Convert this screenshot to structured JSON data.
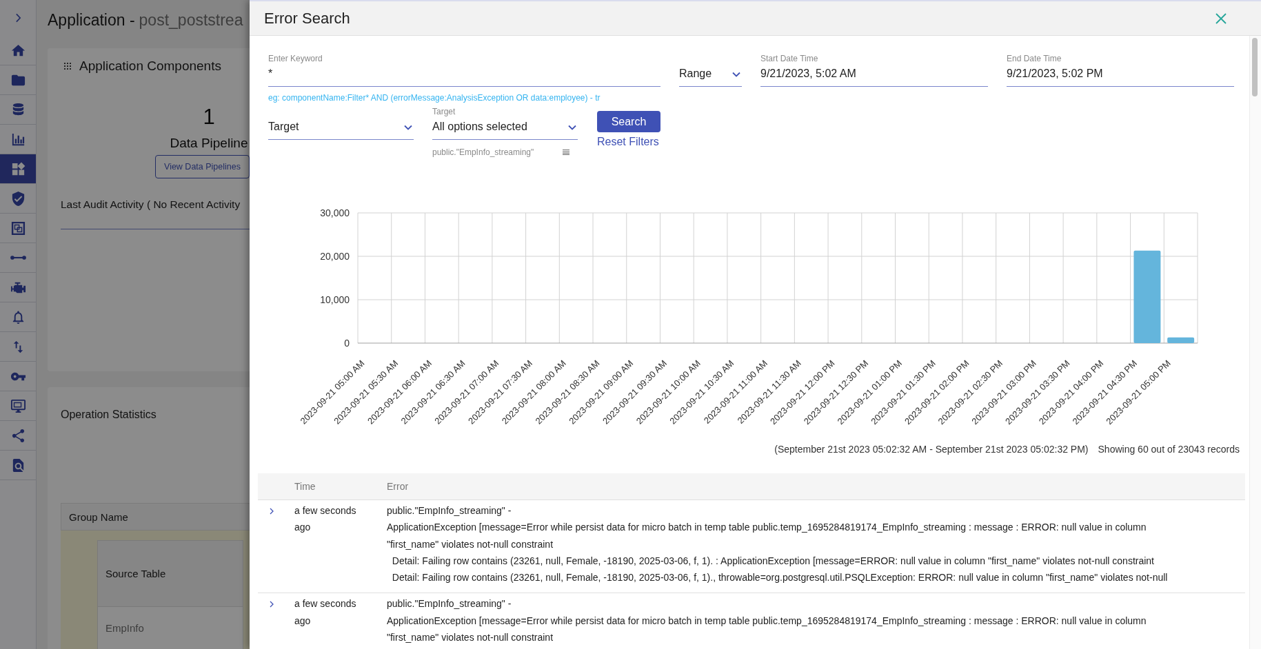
{
  "sidebar": {
    "items": [
      {
        "kind": "home",
        "selected": false
      },
      {
        "kind": "folder",
        "selected": false
      },
      {
        "kind": "database",
        "selected": false
      },
      {
        "kind": "chart",
        "selected": false
      },
      {
        "kind": "widgets",
        "selected": true
      },
      {
        "kind": "shield",
        "selected": false
      },
      {
        "kind": "layers",
        "selected": false
      },
      {
        "kind": "connector",
        "selected": false
      },
      {
        "kind": "engine",
        "selected": false
      },
      {
        "kind": "bell",
        "selected": false
      },
      {
        "kind": "transfer",
        "selected": false
      },
      {
        "kind": "key",
        "selected": false
      },
      {
        "kind": "monitor",
        "selected": false
      },
      {
        "kind": "share",
        "selected": false
      },
      {
        "kind": "search_doc",
        "selected": false
      }
    ]
  },
  "page": {
    "title": "Application -",
    "app_name": "post_poststrea"
  },
  "components_card": {
    "title": "Application Components",
    "count": "1",
    "count_label": "Data Pipeline",
    "button": "View Data Pipelines",
    "audit": "Last Audit Activity ( No Recent Activity"
  },
  "statistics_card": {
    "title": "Operation Statistics",
    "table": {
      "header": "Group Name",
      "columns": [
        "Source Table"
      ],
      "rows": [
        [
          "EmpInfo"
        ]
      ]
    }
  },
  "dialog": {
    "title": "Error Search",
    "keyword": {
      "label": "Enter Keyword",
      "value": "*",
      "hint": "eg: componentName:Filter* AND (errorMessage:AnalysisException OR data:employee) - tr"
    },
    "range": {
      "value": "Range"
    },
    "start": {
      "label": "Start Date Time",
      "value": "9/21/2023, 5:02 AM"
    },
    "end": {
      "label": "End Date Time",
      "value": "9/21/2023, 5:02 PM"
    },
    "target_type": {
      "value": "Target"
    },
    "target": {
      "label": "Target",
      "value": "All options selected",
      "selected_items": [
        "public.\"EmpInfo_streaming\""
      ]
    },
    "search_button": "Search",
    "reset_link": "Reset Filters",
    "chart_data": {
      "type": "bar",
      "grid": true,
      "categories": [
        "2023-09-21 05:00 AM",
        "2023-09-21 05:30 AM",
        "2023-09-21 06:00 AM",
        "2023-09-21 06:30 AM",
        "2023-09-21 07:00 AM",
        "2023-09-21 07:30 AM",
        "2023-09-21 08:00 AM",
        "2023-09-21 08:30 AM",
        "2023-09-21 09:00 AM",
        "2023-09-21 09:30 AM",
        "2023-09-21 10:00 AM",
        "2023-09-21 10:30 AM",
        "2023-09-21 11:00 AM",
        "2023-09-21 11:30 AM",
        "2023-09-21 12:00 PM",
        "2023-09-21 12:30 PM",
        "2023-09-21 01:00 PM",
        "2023-09-21 01:30 PM",
        "2023-09-21 02:00 PM",
        "2023-09-21 02:30 PM",
        "2023-09-21 03:00 PM",
        "2023-09-21 03:30 PM",
        "2023-09-21 04:00 PM",
        "2023-09-21 04:30 PM",
        "2023-09-21 05:00 PM"
      ],
      "values": [
        0,
        0,
        0,
        0,
        0,
        0,
        0,
        0,
        0,
        0,
        0,
        0,
        0,
        0,
        0,
        0,
        0,
        0,
        0,
        0,
        0,
        0,
        0,
        21300,
        1300
      ],
      "ylim": [
        0,
        30000
      ],
      "yticks": [
        {
          "value": 0,
          "label": "0"
        },
        {
          "value": 10000,
          "label": "10,000"
        },
        {
          "value": 20000,
          "label": "20,000"
        },
        {
          "value": 30000,
          "label": "30,000"
        }
      ]
    },
    "range_caption": "(September 21st 2023 05:02:32 AM - September 21st 2023 05:02:32 PM)",
    "records_caption": "Showing 60 out of 23043 records",
    "table": {
      "columns": [
        "Time",
        "Error"
      ],
      "rows": [
        {
          "expanded": false,
          "time": "a few seconds ago",
          "error": "public.\"EmpInfo_streaming\" -\nApplicationException [message=Error while persist data for micro batch in temp table public.temp_1695284819174_EmpInfo_streaming : message : ERROR: null value in column\n\"first_name\" violates not-null constraint\n  Detail: Failing row contains (23261, null, Female, -18190, 2025-03-06, f, 1). : ApplicationException [message=ERROR: null value in column \"first_name\" violates not-null constraint\n  Detail: Failing row contains (23261, null, Female, -18190, 2025-03-06, f, 1)., throwable=org.postgresql.util.PSQLException: ERROR: null value in column \"first_name\" violates not-null"
        },
        {
          "expanded": false,
          "time": "a few seconds ago",
          "error": "public.\"EmpInfo_streaming\" -\nApplicationException [message=Error while persist data for micro batch in temp table public.temp_1695284819174_EmpInfo_streaming : message : ERROR: null value in column\n\"first_name\" violates not-null constraint"
        }
      ]
    }
  }
}
